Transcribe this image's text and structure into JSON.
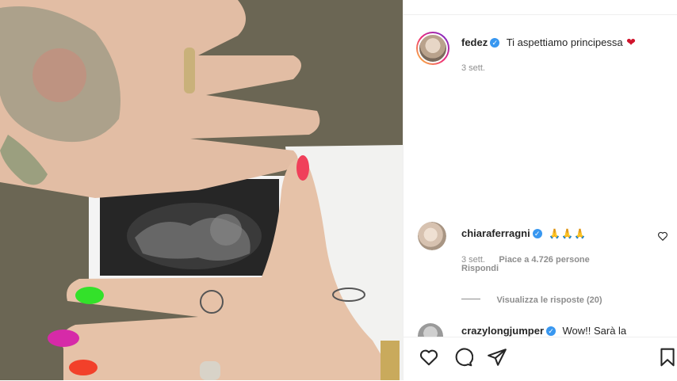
{
  "post": {
    "author": "fedez",
    "caption": "Ti aspettiamo principessa",
    "caption_emoji": "❤",
    "time": "3 sett."
  },
  "comments": [
    {
      "user": "chiaraferragni",
      "text": "🙏🙏🙏",
      "time": "3 sett.",
      "likes": "Piace a 4.726 persone",
      "reply": "Rispondi",
      "view_replies": "Visualizza le risposte (20)"
    },
    {
      "user": "crazylongjumper",
      "text": "Wow!! Sarà la"
    }
  ],
  "icons": {
    "like": "heart-icon",
    "comment": "comment-icon",
    "share": "share-icon",
    "save": "bookmark-icon",
    "comment_like": "small-heart-icon"
  },
  "colors": {
    "verified": "#3897f0",
    "heart": "#d0142c",
    "meta": "#8e8e8e"
  }
}
